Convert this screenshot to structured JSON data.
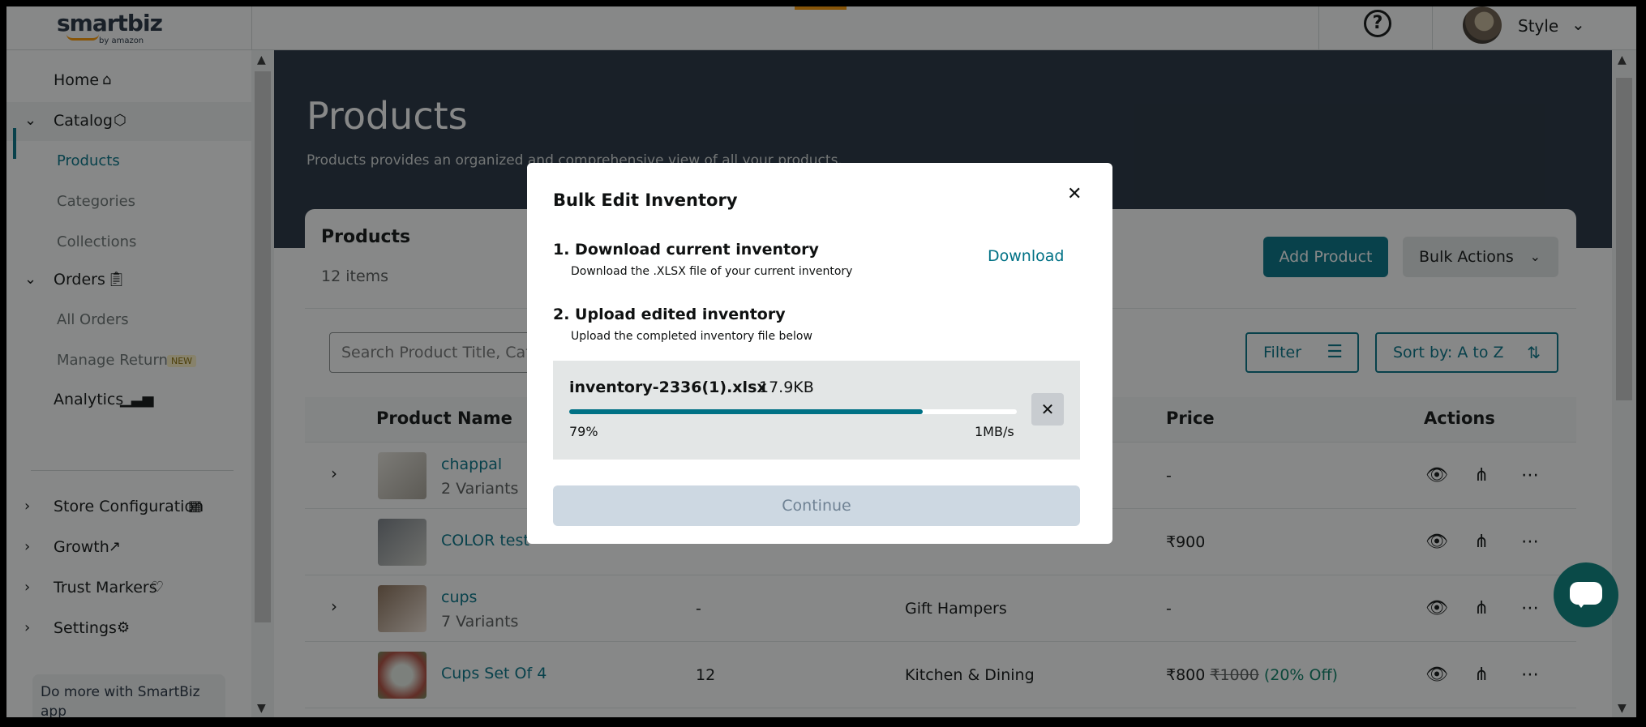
{
  "app": {
    "logo_text": "smartbiz",
    "logo_sub": "by amazon"
  },
  "topbar": {
    "help_glyph": "?",
    "user_name": "Style"
  },
  "sidebar": {
    "items": [
      {
        "label": "Home",
        "icon": "home-icon"
      },
      {
        "label": "Catalog",
        "icon": "cube-icon"
      },
      {
        "label": "Products"
      },
      {
        "label": "Categories"
      },
      {
        "label": "Collections"
      },
      {
        "label": "Orders",
        "icon": "clipboard-icon"
      },
      {
        "label": "All Orders"
      },
      {
        "label": "Manage Returns",
        "badge": "NEW"
      },
      {
        "label": "Analytics",
        "icon": "bar-chart-icon"
      },
      {
        "label": "Store Configuration",
        "icon": "store-icon"
      },
      {
        "label": "Growth",
        "icon": "trend-up-icon"
      },
      {
        "label": "Trust Markers",
        "icon": "badge-heart-icon"
      },
      {
        "label": "Settings",
        "icon": "gear-icon"
      }
    ],
    "promo": "Do more with SmartBiz app"
  },
  "page": {
    "title": "Products",
    "description": "Products provides an organized and comprehensive view of all your products."
  },
  "products_card": {
    "title": "Products",
    "count": "12 items",
    "add_product": "Add Product",
    "bulk_actions": "Bulk Actions",
    "search_placeholder": "Search Product Title, Category",
    "filter": "Filter",
    "sort": "Sort by: A to Z",
    "columns": {
      "name": "Product Name",
      "price": "Price",
      "actions": "Actions"
    },
    "rows": [
      {
        "name": "chappal",
        "variants": "2 Variants",
        "quantity": "",
        "category": "",
        "price": "-",
        "mrp": "",
        "discount": ""
      },
      {
        "name": "COLOR test",
        "variants": "",
        "quantity": "",
        "category": "",
        "price": "₹900",
        "mrp": "",
        "discount": ""
      },
      {
        "name": "cups",
        "variants": "7 Variants",
        "quantity": "-",
        "category": "Gift Hampers",
        "price": "-",
        "mrp": "",
        "discount": ""
      },
      {
        "name": "Cups Set Of 4",
        "variants": "",
        "quantity": "12",
        "category": "Kitchen & Dining",
        "price": "₹800",
        "mrp": "₹1000",
        "discount": "(20% Off)"
      }
    ]
  },
  "modal": {
    "title": "Bulk Edit Inventory",
    "close_glyph": "✕",
    "step1_title": "1. Download current inventory",
    "step1_desc": "Download the .XLSX file of your current inventory",
    "download_label": "Download",
    "step2_title": "2. Upload edited inventory",
    "step2_desc": "Upload the completed inventory file below",
    "upload": {
      "file_name": "inventory-2336(1).xlsx",
      "file_size": "17.9KB",
      "progress_percent": 79,
      "progress_label": "79%",
      "speed": "1MB/s",
      "cancel_glyph": "✕"
    },
    "continue_label": "Continue"
  },
  "colors": {
    "brand_teal": "#007185",
    "header_navy": "#232f3e",
    "accent_orange": "#ff9900",
    "discount_green": "#067d62"
  }
}
